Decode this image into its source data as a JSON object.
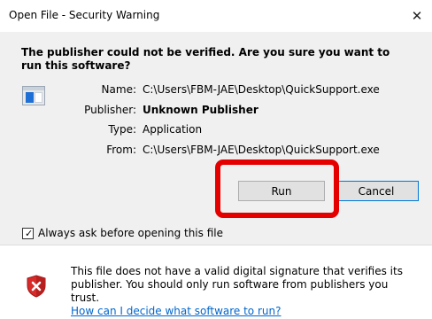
{
  "window": {
    "title": "Open File - Security Warning",
    "close_glyph": "✕"
  },
  "dialog": {
    "headline": "The publisher could not be verified.  Are you sure you want to run this software?",
    "file_icon": "application-window-icon",
    "fields": [
      {
        "label": "Name:",
        "value": "C:\\Users\\FBM-JAE\\Desktop\\QuickSupport.exe"
      },
      {
        "label": "Publisher:",
        "value": "Unknown Publisher"
      },
      {
        "label": "Type:",
        "value": "Application"
      },
      {
        "label": "From:",
        "value": "C:\\Users\\FBM-JAE\\Desktop\\QuickSupport.exe"
      }
    ],
    "buttons": {
      "run_label": "Run",
      "cancel_label": "Cancel"
    },
    "checkbox": {
      "label": "Always ask before opening this file",
      "checked": true,
      "mark": "✓"
    }
  },
  "footer": {
    "icon": "shield-warning-icon",
    "text": "This file does not have a valid digital signature that verifies its publisher.  You should only run software from publishers you trust.",
    "link_text": "How can I decide what software to run?"
  },
  "colors": {
    "highlight_annotation": "#e50000",
    "link": "#0066cc",
    "shield_red": "#d92a2a"
  }
}
